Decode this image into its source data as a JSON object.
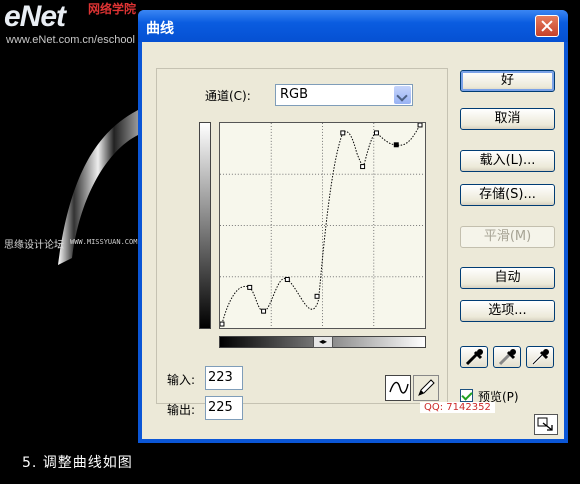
{
  "site": {
    "logo": "eNet",
    "logo_cn": "网络学院",
    "url": "www.eNet.com.cn/eschool",
    "watermark": "思缘设计论坛",
    "watermark_url": "WWW.MISSYUAN.COM",
    "qq": "QQ: 7142352",
    "caption": "5. 调整曲线如图"
  },
  "dialog": {
    "title": "曲线",
    "channel_label": "通道(C):",
    "channel_value": "RGB",
    "input_label": "输入:",
    "input_value": "223",
    "output_label": "输出:",
    "output_value": "225",
    "preview_label": "预览(P)",
    "preview_checked": true,
    "buttons": {
      "ok": "好",
      "cancel": "取消",
      "load": "载入(L)...",
      "save": "存储(S)...",
      "smooth": "平滑(M)",
      "auto": "自动",
      "options": "选项..."
    },
    "icons": [
      "curve-tool-icon",
      "pencil-tool-icon",
      "black-eyedropper-icon",
      "gray-eyedropper-icon",
      "white-eyedropper-icon",
      "close-icon",
      "resize-icon"
    ],
    "curve": {
      "range": [
        0,
        255
      ],
      "grid_divisions": 4,
      "points": [
        [
          0,
          0
        ],
        [
          38,
          36
        ],
        [
          60,
          115
        ],
        [
          120,
          30
        ],
        [
          200,
          250
        ],
        [
          225,
          212
        ],
        [
          255,
          255
        ]
      ]
    }
  }
}
